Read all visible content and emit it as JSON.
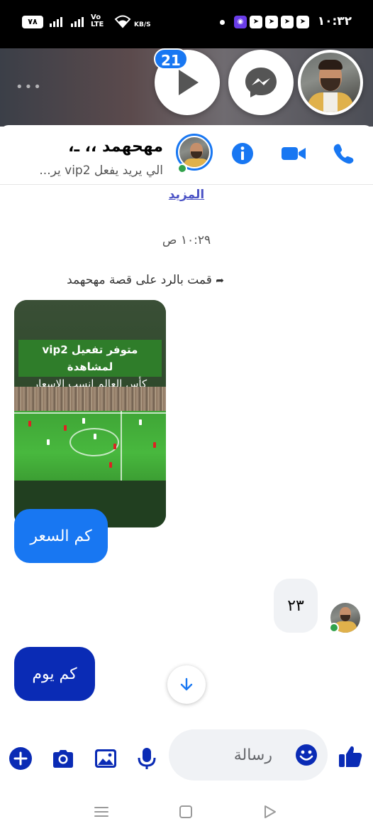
{
  "status_bar": {
    "battery": "٧٨",
    "volte": "Vo\nLTE",
    "net_speed_unit": "KB/S",
    "time": "١٠:٣٢"
  },
  "chat_heads": {
    "unread_badge": "21"
  },
  "header": {
    "contact_name": "مهحهمد ،، ـ،",
    "subtitle": "الي يريد يفعل vip2 ير...",
    "accent_color": "#1877f2"
  },
  "messages": {
    "see_more": "المزيد",
    "time_separator": "١٠:٢٩ ص",
    "replied_to_story": "قمت بالرد على قصة مهحهمد",
    "story_banner_line1": "متوفر تفعيل vip2 لمشاهدة",
    "story_banner_line2": "كأس العالم انسب الاسعار",
    "msg1": "كم السعر",
    "msg2": "٢٣",
    "msg3": "كم يوم"
  },
  "composer": {
    "placeholder": "رسالة"
  }
}
